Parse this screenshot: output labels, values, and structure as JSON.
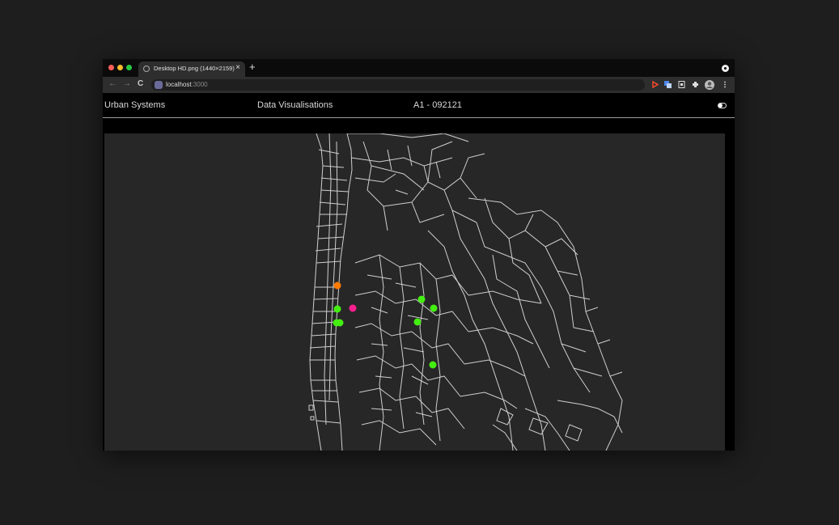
{
  "browser": {
    "tab_title": "Desktop HD.png (1440×2159)",
    "tab_close": "×",
    "new_tab": "+",
    "url_host": "localhost",
    "url_port": ":3000",
    "nav": {
      "back": "←",
      "forward": "→",
      "reload": "C"
    }
  },
  "app": {
    "brand": "Urban Systems",
    "section": "Data Visualisations",
    "code": "A1 - 092121"
  },
  "map": {
    "markers": [
      {
        "kind": "orange",
        "color": "#ff7a00"
      },
      {
        "kind": "magenta",
        "color": "#ff1f8e"
      },
      {
        "kind": "green",
        "color": "#44ee11"
      },
      {
        "kind": "green",
        "color": "#44ee11"
      },
      {
        "kind": "green",
        "color": "#44ee11"
      },
      {
        "kind": "green",
        "color": "#44ee11"
      },
      {
        "kind": "green",
        "color": "#44ee11"
      },
      {
        "kind": "green",
        "color": "#44ee11"
      },
      {
        "kind": "green",
        "color": "#44ee11"
      }
    ]
  },
  "colors": {
    "accent_orange": "#ff7a00",
    "accent_magenta": "#ff1f8e",
    "accent_green": "#44ee11",
    "map_line": "#cfcfcf"
  }
}
